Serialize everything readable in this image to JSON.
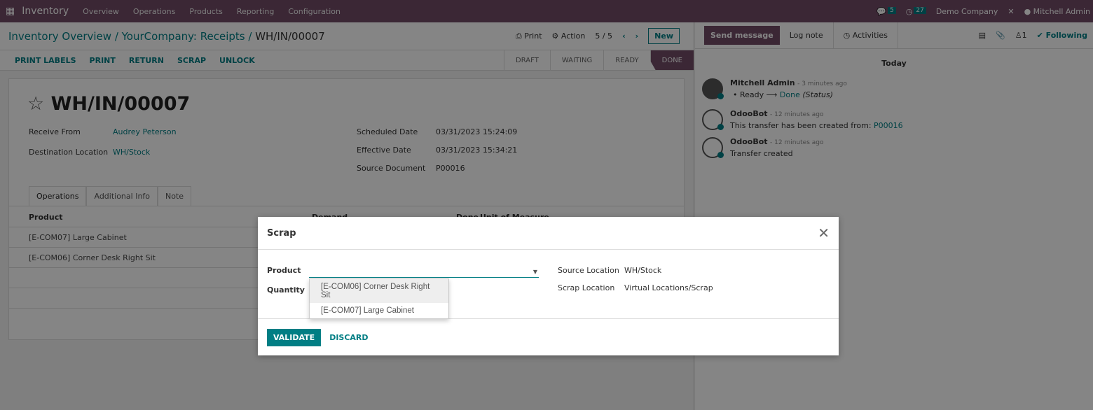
{
  "navbar": {
    "app": "Inventory",
    "menu": [
      "Overview",
      "Operations",
      "Products",
      "Reporting",
      "Configuration"
    ],
    "messages_count": "5",
    "activities_count": "27",
    "company": "Demo Company",
    "user": "Mitchell Admin"
  },
  "breadcrumb": {
    "items": [
      "Inventory Overview",
      "YourCompany: Receipts"
    ],
    "current": "WH/IN/00007"
  },
  "control": {
    "print": "Print",
    "action": "Action",
    "pager": "5 / 5",
    "new": "New"
  },
  "buttons": [
    "PRINT LABELS",
    "PRINT",
    "RETURN",
    "SCRAP",
    "UNLOCK"
  ],
  "stages": {
    "items": [
      "DRAFT",
      "WAITING",
      "READY",
      "DONE"
    ],
    "active": "DONE"
  },
  "record": {
    "title": "WH/IN/00007",
    "receive_from_label": "Receive From",
    "receive_from": "Audrey Peterson",
    "dest_label": "Destination Location",
    "dest": "WH/Stock",
    "scheduled_label": "Scheduled Date",
    "scheduled": "03/31/2023 15:24:09",
    "effective_label": "Effective Date",
    "effective": "03/31/2023 15:34:21",
    "source_label": "Source Document",
    "source": "P00016"
  },
  "tabs": [
    "Operations",
    "Additional Info",
    "Note"
  ],
  "table": {
    "headers": [
      "Product",
      "Demand",
      "Done",
      "Unit of Measure"
    ],
    "rows": [
      "[E-COM07] Large Cabinet",
      "[E-COM06] Corner Desk Right Sit"
    ]
  },
  "chatter": {
    "send": "Send message",
    "log": "Log note",
    "activities": "Activities",
    "followers": "1",
    "following": "Following",
    "today": "Today",
    "messages": [
      {
        "author": "Mitchell Admin",
        "time": "- 3 minutes ago",
        "from": "Ready",
        "to": "Done",
        "field": "(Status)"
      },
      {
        "author": "OdooBot",
        "time": "- 12 minutes ago",
        "text": "This transfer has been created from:",
        "link": "P00016"
      },
      {
        "author": "OdooBot",
        "time": "- 12 minutes ago",
        "text": "Transfer created"
      }
    ]
  },
  "modal": {
    "title": "Scrap",
    "product_label": "Product",
    "product_value": "",
    "quantity_label": "Quantity",
    "source_label": "Source Location",
    "source": "WH/Stock",
    "scrap_label": "Scrap Location",
    "scrap": "Virtual Locations/Scrap",
    "options": [
      "[E-COM06] Corner Desk Right Sit",
      "[E-COM07] Large Cabinet"
    ],
    "validate": "VALIDATE",
    "discard": "DISCARD"
  }
}
